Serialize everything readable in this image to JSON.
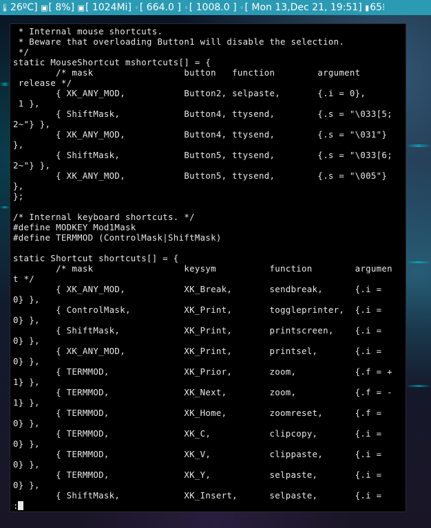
{
  "status_bar": {
    "segments": [
      {
        "icon": "thermometer-icon",
        "glyph": "🌡",
        "text": "26ºC]"
      },
      {
        "icon": "cpu-icon",
        "glyph": "▣",
        "text": "[ 8%]"
      },
      {
        "icon": "memory-icon",
        "glyph": "▣",
        "text": "[ 1024Mi]"
      },
      {
        "icon": "disk-icon",
        "glyph": "◦",
        "text": "[ 664.0 ]"
      },
      {
        "icon": "disk-icon",
        "glyph": "◦",
        "text": "[ 1008.0 ]"
      },
      {
        "icon": "clock-icon",
        "glyph": "◦",
        "text": "[ Mon 13,Dec 21, 19:51]"
      },
      {
        "icon": "battery-icon",
        "glyph": "▮",
        "text": "65⁝"
      }
    ]
  },
  "terminal": {
    "lines": [
      " * Internal mouse shortcuts.",
      " * Beware that overloading Button1 will disable the selection.",
      " */",
      "static MouseShortcut mshortcuts[] = {",
      "        /* mask                 button   function        argument",
      " release */",
      "        { XK_ANY_MOD,           Button2, selpaste,       {.i = 0},",
      " 1 },",
      "        { ShiftMask,            Button4, ttysend,        {.s = \"\\033[5;",
      "2~\"} },",
      "        { XK_ANY_MOD,           Button4, ttysend,        {.s = \"\\031\"}",
      "},",
      "        { ShiftMask,            Button5, ttysend,        {.s = \"\\033[6;",
      "2~\"} },",
      "        { XK_ANY_MOD,           Button5, ttysend,        {.s = \"\\005\"}",
      "},",
      "};",
      "",
      "/* Internal keyboard shortcuts. */",
      "#define MODKEY Mod1Mask",
      "#define TERMMOD (ControlMask|ShiftMask)",
      "",
      "static Shortcut shortcuts[] = {",
      "        /* mask                 keysym          function        argumen",
      "t */",
      "        { XK_ANY_MOD,           XK_Break,       sendbreak,      {.i =",
      "0} },",
      "        { ControlMask,          XK_Print,       toggleprinter,  {.i =",
      "0} },",
      "        { ShiftMask,            XK_Print,       printscreen,    {.i =",
      "0} },",
      "        { XK_ANY_MOD,           XK_Print,       printsel,       {.i =",
      "0} },",
      "        { TERMMOD,              XK_Prior,       zoom,           {.f = +",
      "1} },",
      "        { TERMMOD,              XK_Next,        zoom,           {.f = -",
      "1} },",
      "        { TERMMOD,              XK_Home,        zoomreset,      {.f =",
      "0} },",
      "        { TERMMOD,              XK_C,           clipcopy,       {.i =",
      "0} },",
      "        { TERMMOD,              XK_V,           clippaste,      {.i =",
      "0} },",
      "        { TERMMOD,              XK_Y,           selpaste,       {.i =",
      "0} },",
      "        { ShiftMask,            XK_Insert,      selpaste,       {.i ="
    ],
    "prompt": ":"
  }
}
